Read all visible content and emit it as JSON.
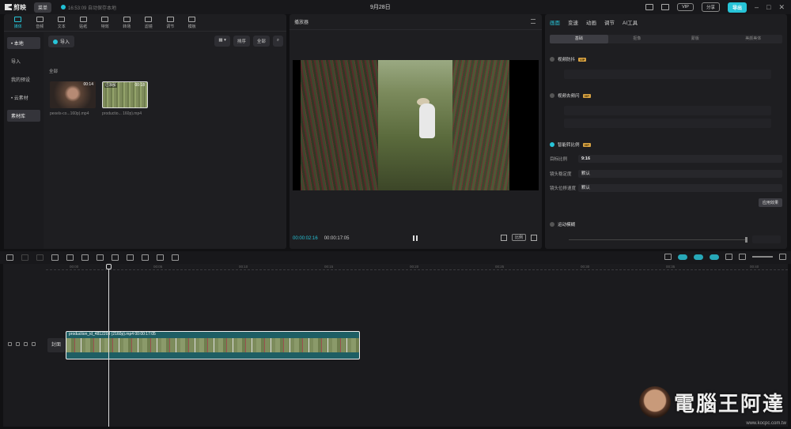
{
  "titlebar": {
    "app_name": "剪映",
    "menu_label": "菜单",
    "autosave": "16:53:09 自动保存本地",
    "date": "9月28日",
    "vip_label": "VIP",
    "share_label": "分享",
    "export_label": "导出"
  },
  "media": {
    "tabs": [
      {
        "label": "媒体",
        "icon": "media-icon"
      },
      {
        "label": "音频",
        "icon": "audio-icon"
      },
      {
        "label": "文本",
        "icon": "text-icon"
      },
      {
        "label": "贴纸",
        "icon": "sticker-icon"
      },
      {
        "label": "特效",
        "icon": "effects-icon"
      },
      {
        "label": "转场",
        "icon": "transition-icon"
      },
      {
        "label": "滤镜",
        "icon": "filter-icon"
      },
      {
        "label": "调节",
        "icon": "adjust-icon"
      },
      {
        "label": "模板",
        "icon": "template-icon"
      }
    ],
    "side": [
      "• 本地",
      "导入",
      "我的预设",
      "• 云素材",
      "素材库"
    ],
    "import_label": "导入",
    "sort_label": "排序",
    "filter_label": "全部",
    "all_label": "全部",
    "items": [
      {
        "name": "pexels-co...160p).mp4",
        "duration": "00:14",
        "added": ""
      },
      {
        "name": "productio... 160p).mp4",
        "duration": "00:18",
        "added": "已添加"
      }
    ]
  },
  "player": {
    "title": "播放器",
    "current_time": "00:00:02:16",
    "total_time": "00:00:17:05",
    "ratio_label": "比例"
  },
  "props": {
    "tabs": [
      "画面",
      "变速",
      "动画",
      "调节",
      "AI工具"
    ],
    "subtabs": [
      "基础",
      "抠像",
      "蒙版",
      "美颜美体"
    ],
    "sec1": "视频防抖",
    "sec2": "视频去频闪",
    "sec3": "智能转比例",
    "vip_tag": "VIP",
    "ratio_label": "目标比例",
    "ratio_value": "9:16",
    "stability_label": "镜头稳定度",
    "stability_value": "默认",
    "speed_label": "镜头位移速度",
    "speed_value": "默认",
    "apply_label": "应用效果",
    "sec4": "运动模糊"
  },
  "timeline": {
    "ticks": [
      "00:00",
      "00:05",
      "00:10",
      "00:15",
      "00:20",
      "00:25",
      "00:30",
      "00:35",
      "00:40"
    ],
    "cover_label": "封面",
    "clip_name": "production_id_4812203 (2160p).mp4  00:00:17:05"
  },
  "watermark": {
    "text": "電腦王阿達",
    "url": "www.kocpc.com.tw"
  },
  "colors": {
    "accent": "#27c4d8",
    "vip": "#d8a243",
    "clip": "#1e5e64"
  }
}
